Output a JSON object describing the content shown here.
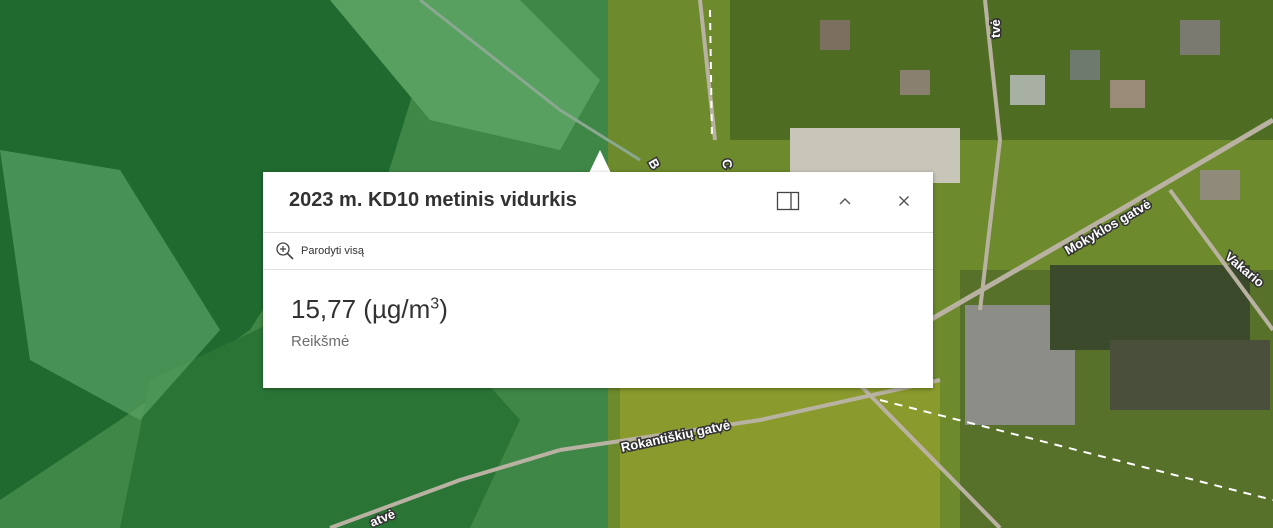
{
  "popup": {
    "title": "2023 m. KD10 metinis vidurkis",
    "zoom_action_label": "Parodyti visą",
    "value_text": "15,77 (µg/m",
    "value_superscript": "3",
    "value_suffix": ")",
    "value_label": "Reikšmė",
    "buttons": {
      "dock": "dock-icon",
      "collapse": "chevron-up-icon",
      "close": "close-icon"
    }
  },
  "map": {
    "street_labels": {
      "top_partial": "tvė",
      "b_partial": "B",
      "c_partial": "C",
      "mokyklos": "Mokyklos gatvė",
      "vakario": "Vakario",
      "rokantiskiu": "Rokantiškių gatvė",
      "bottom_partial": "atvė"
    },
    "colors": {
      "green_overlay": "#3a8a44",
      "yellow_green": "#7a9a2a",
      "roads": "#b9b2a2"
    }
  }
}
